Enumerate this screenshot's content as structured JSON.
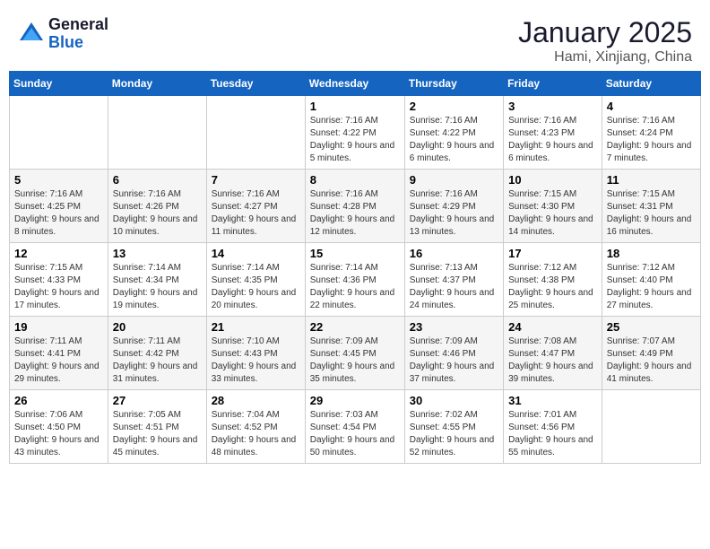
{
  "header": {
    "logo_general": "General",
    "logo_blue": "Blue",
    "month": "January 2025",
    "location": "Hami, Xinjiang, China"
  },
  "weekdays": [
    "Sunday",
    "Monday",
    "Tuesday",
    "Wednesday",
    "Thursday",
    "Friday",
    "Saturday"
  ],
  "weeks": [
    [
      {
        "day": "",
        "info": ""
      },
      {
        "day": "",
        "info": ""
      },
      {
        "day": "",
        "info": ""
      },
      {
        "day": "1",
        "info": "Sunrise: 7:16 AM\nSunset: 4:22 PM\nDaylight: 9 hours and 5 minutes."
      },
      {
        "day": "2",
        "info": "Sunrise: 7:16 AM\nSunset: 4:22 PM\nDaylight: 9 hours and 6 minutes."
      },
      {
        "day": "3",
        "info": "Sunrise: 7:16 AM\nSunset: 4:23 PM\nDaylight: 9 hours and 6 minutes."
      },
      {
        "day": "4",
        "info": "Sunrise: 7:16 AM\nSunset: 4:24 PM\nDaylight: 9 hours and 7 minutes."
      }
    ],
    [
      {
        "day": "5",
        "info": "Sunrise: 7:16 AM\nSunset: 4:25 PM\nDaylight: 9 hours and 8 minutes."
      },
      {
        "day": "6",
        "info": "Sunrise: 7:16 AM\nSunset: 4:26 PM\nDaylight: 9 hours and 10 minutes."
      },
      {
        "day": "7",
        "info": "Sunrise: 7:16 AM\nSunset: 4:27 PM\nDaylight: 9 hours and 11 minutes."
      },
      {
        "day": "8",
        "info": "Sunrise: 7:16 AM\nSunset: 4:28 PM\nDaylight: 9 hours and 12 minutes."
      },
      {
        "day": "9",
        "info": "Sunrise: 7:16 AM\nSunset: 4:29 PM\nDaylight: 9 hours and 13 minutes."
      },
      {
        "day": "10",
        "info": "Sunrise: 7:15 AM\nSunset: 4:30 PM\nDaylight: 9 hours and 14 minutes."
      },
      {
        "day": "11",
        "info": "Sunrise: 7:15 AM\nSunset: 4:31 PM\nDaylight: 9 hours and 16 minutes."
      }
    ],
    [
      {
        "day": "12",
        "info": "Sunrise: 7:15 AM\nSunset: 4:33 PM\nDaylight: 9 hours and 17 minutes."
      },
      {
        "day": "13",
        "info": "Sunrise: 7:14 AM\nSunset: 4:34 PM\nDaylight: 9 hours and 19 minutes."
      },
      {
        "day": "14",
        "info": "Sunrise: 7:14 AM\nSunset: 4:35 PM\nDaylight: 9 hours and 20 minutes."
      },
      {
        "day": "15",
        "info": "Sunrise: 7:14 AM\nSunset: 4:36 PM\nDaylight: 9 hours and 22 minutes."
      },
      {
        "day": "16",
        "info": "Sunrise: 7:13 AM\nSunset: 4:37 PM\nDaylight: 9 hours and 24 minutes."
      },
      {
        "day": "17",
        "info": "Sunrise: 7:12 AM\nSunset: 4:38 PM\nDaylight: 9 hours and 25 minutes."
      },
      {
        "day": "18",
        "info": "Sunrise: 7:12 AM\nSunset: 4:40 PM\nDaylight: 9 hours and 27 minutes."
      }
    ],
    [
      {
        "day": "19",
        "info": "Sunrise: 7:11 AM\nSunset: 4:41 PM\nDaylight: 9 hours and 29 minutes."
      },
      {
        "day": "20",
        "info": "Sunrise: 7:11 AM\nSunset: 4:42 PM\nDaylight: 9 hours and 31 minutes."
      },
      {
        "day": "21",
        "info": "Sunrise: 7:10 AM\nSunset: 4:43 PM\nDaylight: 9 hours and 33 minutes."
      },
      {
        "day": "22",
        "info": "Sunrise: 7:09 AM\nSunset: 4:45 PM\nDaylight: 9 hours and 35 minutes."
      },
      {
        "day": "23",
        "info": "Sunrise: 7:09 AM\nSunset: 4:46 PM\nDaylight: 9 hours and 37 minutes."
      },
      {
        "day": "24",
        "info": "Sunrise: 7:08 AM\nSunset: 4:47 PM\nDaylight: 9 hours and 39 minutes."
      },
      {
        "day": "25",
        "info": "Sunrise: 7:07 AM\nSunset: 4:49 PM\nDaylight: 9 hours and 41 minutes."
      }
    ],
    [
      {
        "day": "26",
        "info": "Sunrise: 7:06 AM\nSunset: 4:50 PM\nDaylight: 9 hours and 43 minutes."
      },
      {
        "day": "27",
        "info": "Sunrise: 7:05 AM\nSunset: 4:51 PM\nDaylight: 9 hours and 45 minutes."
      },
      {
        "day": "28",
        "info": "Sunrise: 7:04 AM\nSunset: 4:52 PM\nDaylight: 9 hours and 48 minutes."
      },
      {
        "day": "29",
        "info": "Sunrise: 7:03 AM\nSunset: 4:54 PM\nDaylight: 9 hours and 50 minutes."
      },
      {
        "day": "30",
        "info": "Sunrise: 7:02 AM\nSunset: 4:55 PM\nDaylight: 9 hours and 52 minutes."
      },
      {
        "day": "31",
        "info": "Sunrise: 7:01 AM\nSunset: 4:56 PM\nDaylight: 9 hours and 55 minutes."
      },
      {
        "day": "",
        "info": ""
      }
    ]
  ]
}
